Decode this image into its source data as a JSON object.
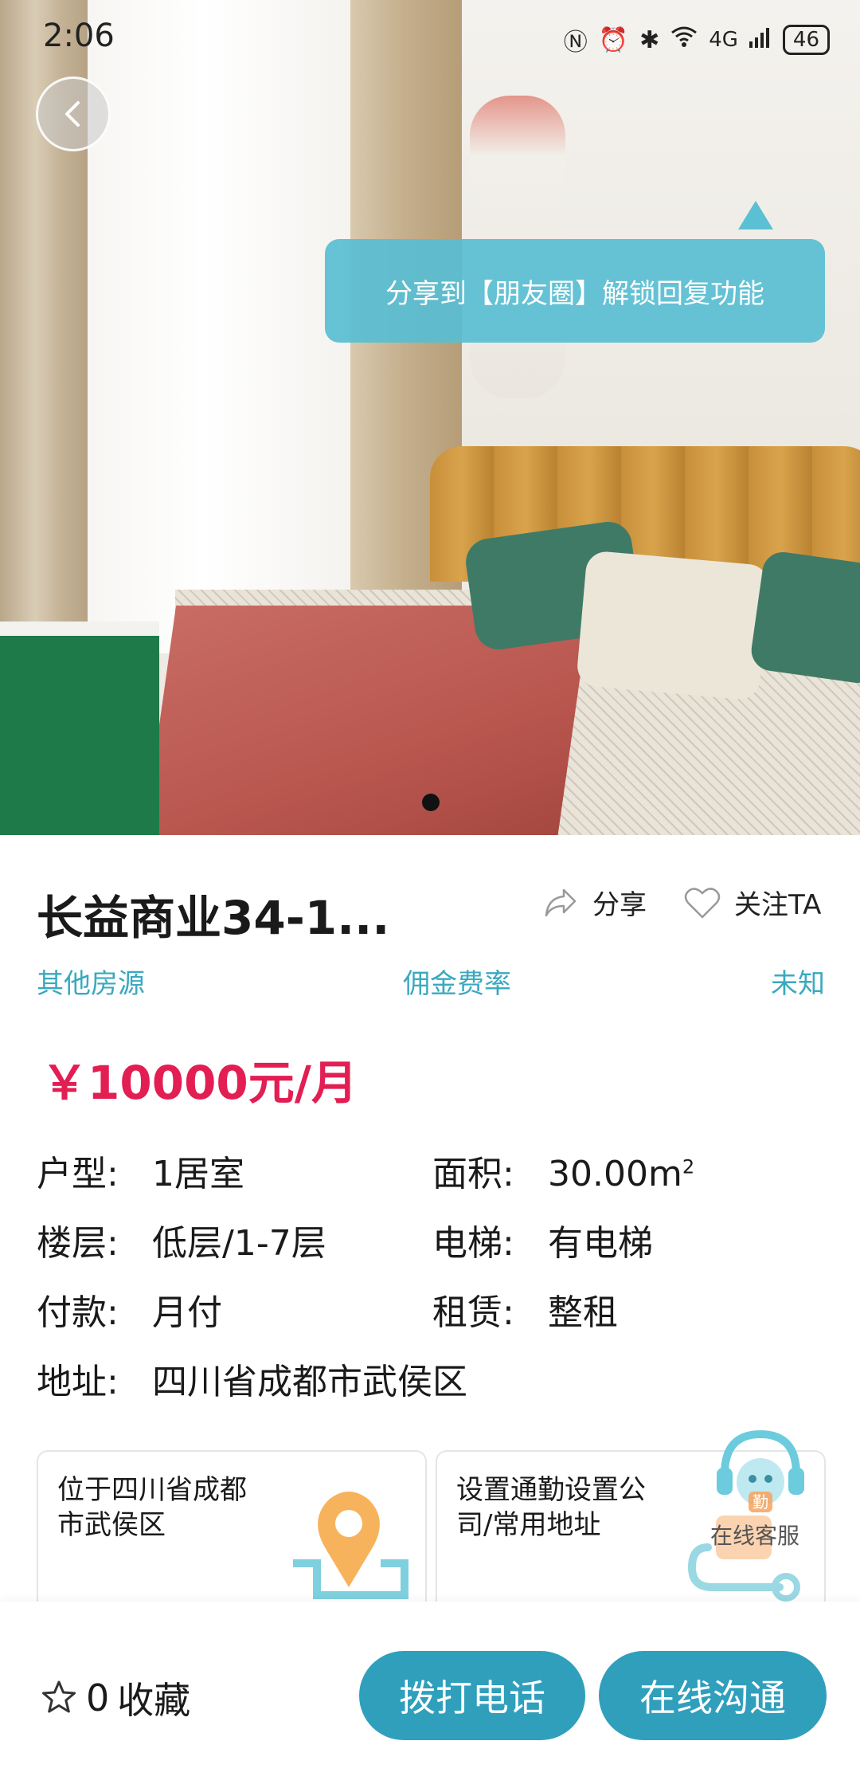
{
  "status_bar": {
    "time": "2:06",
    "network": "4G",
    "battery": "46"
  },
  "tooltip": {
    "text": "分享到【朋友圈】解锁回复功能"
  },
  "listing": {
    "title": "长益商业34-1...",
    "share_label": "分享",
    "follow_label": "关注TA",
    "source": "其他房源",
    "commission_label": "佣金费率",
    "commission_value": "未知",
    "price": "￥10000元/月"
  },
  "props": {
    "layout_label": "户型:",
    "layout_value": "1居室",
    "area_label": "面积:",
    "area_value": "30.00m",
    "area_unit_sup": "2",
    "floor_label": "楼层:",
    "floor_value": "低层/1-7层",
    "elevator_label": "电梯:",
    "elevator_value": "有电梯",
    "payment_label": "付款:",
    "payment_value": "月付",
    "lease_label": "租赁:",
    "lease_value": "整租",
    "address_label": "地址:",
    "address_value": "四川省成都市武侯区"
  },
  "cards": {
    "location": "位于四川省成都市武侯区",
    "commute": "设置通勤设置公司/常用地址"
  },
  "service": {
    "label": "在线客服",
    "badge": "勤"
  },
  "bottom_bar": {
    "favorite_count": "0",
    "favorite_label": "收藏",
    "call_label": "拨打电话",
    "chat_label": "在线沟通"
  },
  "colors": {
    "accent": "#2f9fbc",
    "price": "#e21e53",
    "meta": "#3aa9bf",
    "tooltip": "#58bed3"
  },
  "icons": [
    "back-icon",
    "share-icon",
    "heart-icon",
    "star-icon",
    "location-pin-icon",
    "commute-icon",
    "customer-service-icon"
  ]
}
